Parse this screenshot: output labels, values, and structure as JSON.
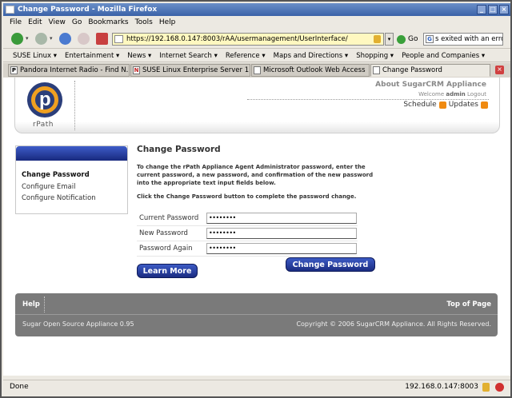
{
  "window": {
    "title": "Change Password - Mozilla Firefox"
  },
  "menubar": [
    "File",
    "Edit",
    "View",
    "Go",
    "Bookmarks",
    "Tools",
    "Help"
  ],
  "navbar": {
    "url": "https://192.168.0.147:8003/rAA/usermanagement/UserInterface/",
    "go_label": "Go",
    "search_value": "s exited with an error"
  },
  "bookmarks": [
    "SUSE Linux ▾",
    "Entertainment ▾",
    "News ▾",
    "Internet Search ▾",
    "Reference ▾",
    "Maps and Directions ▾",
    "Shopping ▾",
    "People and Companies ▾"
  ],
  "tabs": [
    {
      "label": "Pandora Internet Radio - Find N...",
      "icon": "P"
    },
    {
      "label": "SUSE Linux Enterprise Server 1...",
      "icon": "N"
    },
    {
      "label": "Microsoft Outlook Web Access",
      "icon": ""
    },
    {
      "label": "Change Password",
      "icon": ""
    }
  ],
  "header": {
    "brand": "rPath",
    "about": "About SugarCRM Appliance",
    "welcome_prefix": "Welcome",
    "welcome_user": "admin",
    "logout": "Logout",
    "schedule": "Schedule",
    "updates": "Updates"
  },
  "sidebar": {
    "items": [
      "Change Password",
      "Configure Email",
      "Configure Notification"
    ]
  },
  "main": {
    "title": "Change Password",
    "instructions": "To change the rPath Appliance Agent Administrator password, enter the current password, a new password, and confirmation of the new password into the appropriate text input fields below.",
    "instructions2": "Click the Change Password button to complete the password change.",
    "fields": [
      {
        "label": "Current Password",
        "value": "••••••••"
      },
      {
        "label": "New Password",
        "value": "••••••••"
      },
      {
        "label": "Password Again",
        "value": "••••••••"
      }
    ],
    "submit_label": "Change Password",
    "learn_more_label": "Learn More"
  },
  "footer": {
    "help": "Help",
    "top": "Top of Page",
    "version": "Sugar Open Source Appliance 0.95",
    "copyright": "Copyright © 2006 SugarCRM Appliance. All Rights Reserved."
  },
  "status": {
    "text": "Done",
    "host": "192.168.0.147:8003"
  },
  "colors": {
    "button_blue": "#1a2c82",
    "footer_gray": "#7a7a7a",
    "rss_orange": "#f08a10"
  }
}
